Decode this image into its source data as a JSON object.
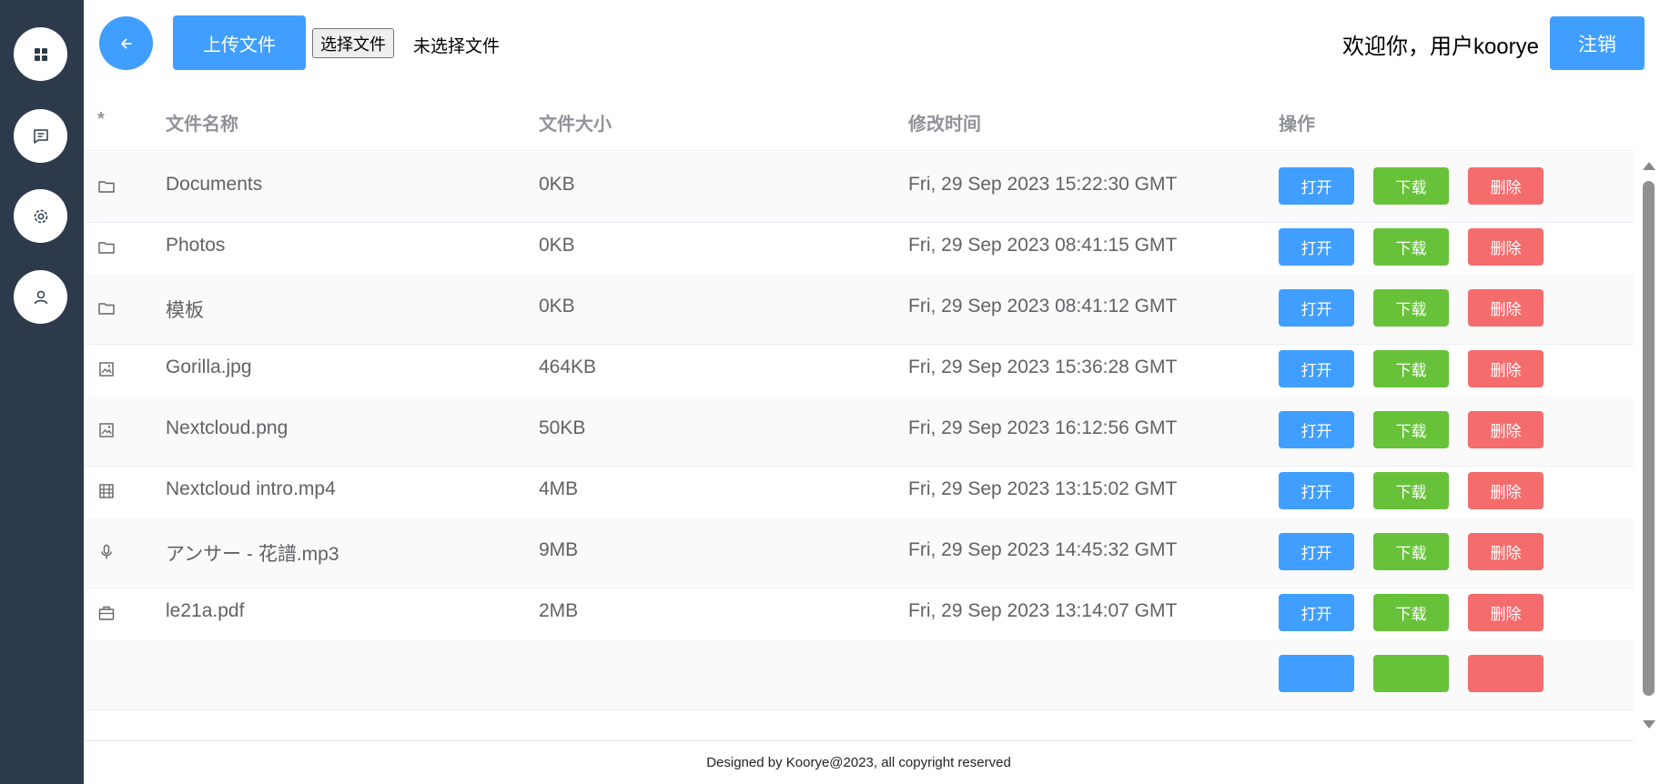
{
  "sidebar": {
    "items": [
      {
        "icon": "grid-icon"
      },
      {
        "icon": "chat-icon"
      },
      {
        "icon": "gear-icon"
      },
      {
        "icon": "user-icon"
      }
    ]
  },
  "toolbar": {
    "upload_label": "上传文件",
    "choose_file_label": "选择文件",
    "no_file_text": "未选择文件",
    "welcome_text": "欢迎你，用户koorye",
    "logout_label": "注销"
  },
  "table": {
    "columns": [
      "*",
      "文件名称",
      "文件大小",
      "修改时间",
      "操作"
    ],
    "action_labels": {
      "open": "打开",
      "download": "下载",
      "delete": "删除"
    },
    "rows": [
      {
        "icon": "folder-icon",
        "name": "Documents",
        "size": "0KB",
        "modified": "Fri, 29 Sep 2023 15:22:30 GMT"
      },
      {
        "icon": "folder-icon",
        "name": "Photos",
        "size": "0KB",
        "modified": "Fri, 29 Sep 2023 08:41:15 GMT"
      },
      {
        "icon": "folder-icon",
        "name": "模板",
        "size": "0KB",
        "modified": "Fri, 29 Sep 2023 08:41:12 GMT"
      },
      {
        "icon": "image-icon",
        "name": "Gorilla.jpg",
        "size": "464KB",
        "modified": "Fri, 29 Sep 2023 15:36:28 GMT"
      },
      {
        "icon": "image-icon",
        "name": "Nextcloud.png",
        "size": "50KB",
        "modified": "Fri, 29 Sep 2023 16:12:56 GMT"
      },
      {
        "icon": "film-icon",
        "name": "Nextcloud intro.mp4",
        "size": "4MB",
        "modified": "Fri, 29 Sep 2023 13:15:02 GMT"
      },
      {
        "icon": "microphone-icon",
        "name": "アンサー - 花譜.mp3",
        "size": "9MB",
        "modified": "Fri, 29 Sep 2023 14:45:32 GMT"
      },
      {
        "icon": "briefcase-icon",
        "name": "le21a.pdf",
        "size": "2MB",
        "modified": "Fri, 29 Sep 2023 13:14:07 GMT"
      }
    ]
  },
  "footer": {
    "text": "Designed by Koorye@2023, all copyright reserved"
  },
  "colors": {
    "sidebar_bg": "#2d3a4b",
    "primary": "#409eff",
    "success": "#67c23a",
    "danger": "#f56c6c"
  }
}
